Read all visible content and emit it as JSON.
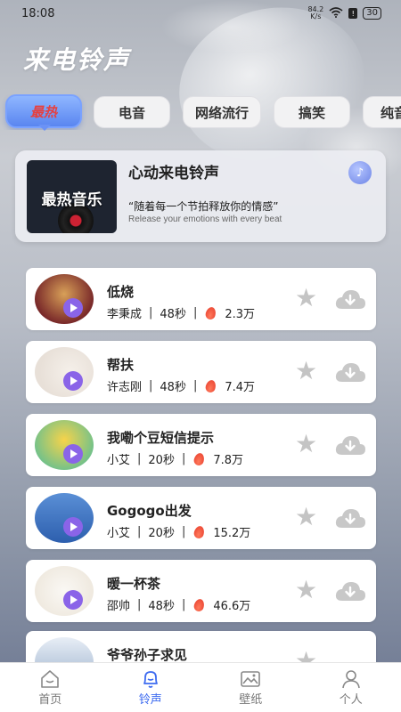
{
  "status_bar": {
    "time": "18:08",
    "net_speed_value": "84.2",
    "net_speed_unit": "K/s",
    "battery": "30"
  },
  "page_title": "来电铃声",
  "tabs": [
    {
      "label": "最热",
      "active": true
    },
    {
      "label": "电音",
      "active": false
    },
    {
      "label": "网络流行",
      "active": false
    },
    {
      "label": "搞笑",
      "active": false
    },
    {
      "label": "纯音",
      "active": false
    }
  ],
  "feature": {
    "cover_text": "最热音乐",
    "title": "心动来电铃声",
    "quote": "“随着每一个节拍释放你的情感”",
    "subtitle": "Release your emotions with every beat"
  },
  "songs": [
    {
      "title": "低烧",
      "artist": "李秉成",
      "duration": "48秒",
      "hot": "2.3万"
    },
    {
      "title": "帮扶",
      "artist": "许志刚",
      "duration": "48秒",
      "hot": "7.4万"
    },
    {
      "title": "我嘞个豆短信提示",
      "artist": "小艾",
      "duration": "20秒",
      "hot": "7.8万"
    },
    {
      "title": "Gogogo出发",
      "artist": "小艾",
      "duration": "20秒",
      "hot": "15.2万"
    },
    {
      "title": "暖一杯茶",
      "artist": "邵帅",
      "duration": "48秒",
      "hot": "46.6万"
    },
    {
      "title": "爷爷孙子求见",
      "artist": "",
      "duration": "",
      "hot": ""
    }
  ],
  "bottom_nav": [
    {
      "label": "首页",
      "icon": "home-icon",
      "active": false
    },
    {
      "label": "铃声",
      "icon": "bell-icon",
      "active": true
    },
    {
      "label": "壁纸",
      "icon": "image-icon",
      "active": false
    },
    {
      "label": "个人",
      "icon": "person-icon",
      "active": false
    }
  ],
  "colors": {
    "accent": "#3d6bf0",
    "active_tab_text": "#e64040",
    "play_button": "#8a64e8",
    "flame": "#e63a2a"
  }
}
